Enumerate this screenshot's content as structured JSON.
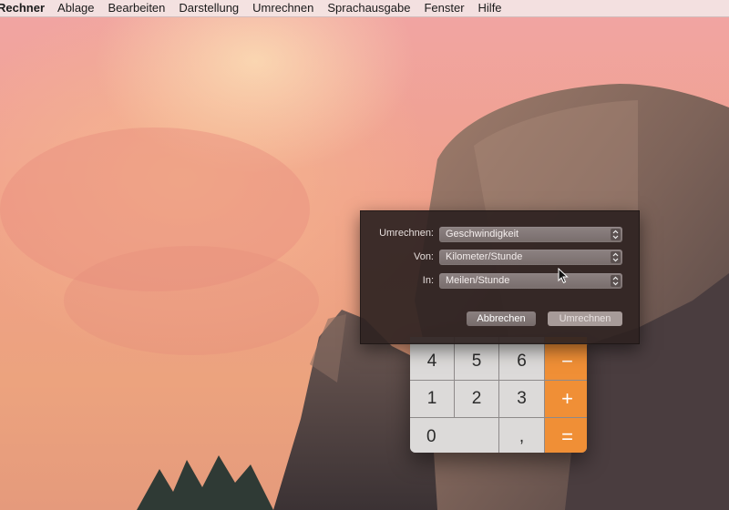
{
  "menubar": {
    "app_name": "Rechner",
    "items": [
      "Ablage",
      "Bearbeiten",
      "Darstellung",
      "Umrechnen",
      "Sprachausgabe",
      "Fenster",
      "Hilfe"
    ]
  },
  "convert_sheet": {
    "type_label": "Umrechnen:",
    "type_value": "Geschwindigkeit",
    "from_label": "Von:",
    "from_value": "Kilometer/Stunde",
    "to_label": "In:",
    "to_value": "Meilen/Stunde",
    "cancel_label": "Abbrechen",
    "convert_label": "Umrechnen"
  },
  "calculator": {
    "keys": {
      "k4": "4",
      "k5": "5",
      "k6": "6",
      "minus": "−",
      "k1": "1",
      "k2": "2",
      "k3": "3",
      "plus": "+",
      "k0": "0",
      "comma": ",",
      "equals": "="
    }
  },
  "colors": {
    "operator_orange": "#f08f36",
    "sheet_background": "#2e2221",
    "menubar_background": "#f3e5e5"
  }
}
